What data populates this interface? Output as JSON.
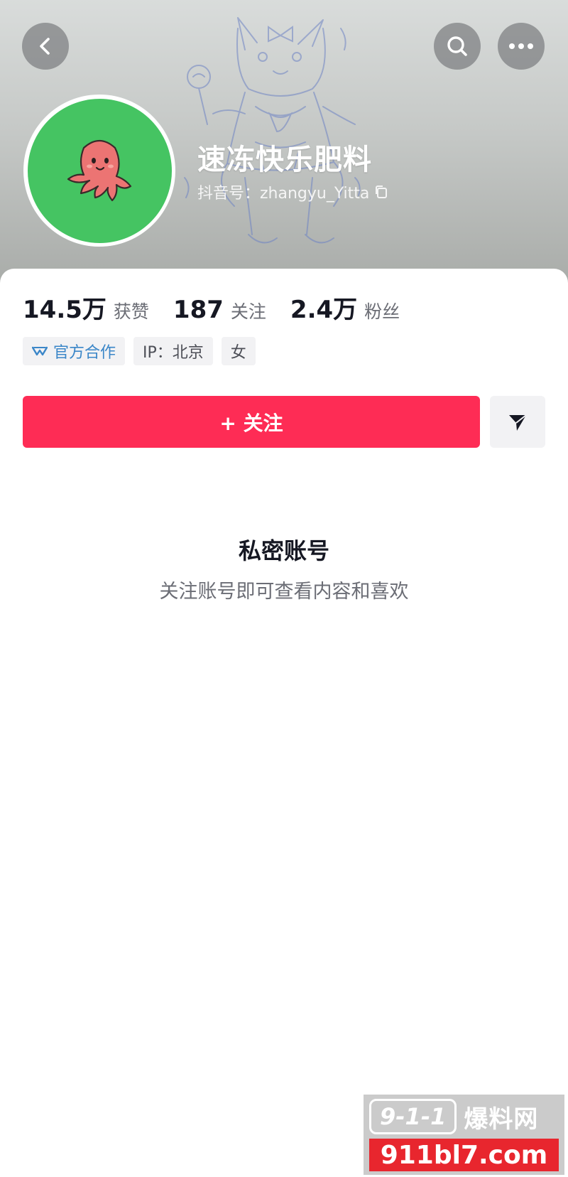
{
  "colors": {
    "accent": "#fe2c55",
    "official_blue": "#3a86c8",
    "avatar_green": "#45c462",
    "tag_bg": "#f2f2f4",
    "watermark_red": "#e8262e"
  },
  "header": {
    "back_icon": "chevron-left-icon",
    "search_icon": "search-icon",
    "more_icon": "more-dots-icon"
  },
  "profile": {
    "avatar_icon": "octopus-avatar",
    "nickname": "速冻快乐肥料",
    "account_id": "抖音号：zhangyu_Yitta",
    "copy_icon": "copy-icon"
  },
  "stats": [
    {
      "value": "14.5万",
      "label": "获赞"
    },
    {
      "value": "187",
      "label": "关注"
    },
    {
      "value": "2.4万",
      "label": "粉丝"
    }
  ],
  "tags": {
    "official": "官方合作",
    "ip": "IP：北京",
    "gender": "女"
  },
  "actions": {
    "follow_label": "+ 关注",
    "share_icon": "send-icon"
  },
  "private": {
    "title": "私密账号",
    "description": "关注账号即可查看内容和喜欢"
  },
  "watermark": {
    "logo": "9-1-1",
    "brand": "爆料网",
    "url": "911bl7.com"
  }
}
